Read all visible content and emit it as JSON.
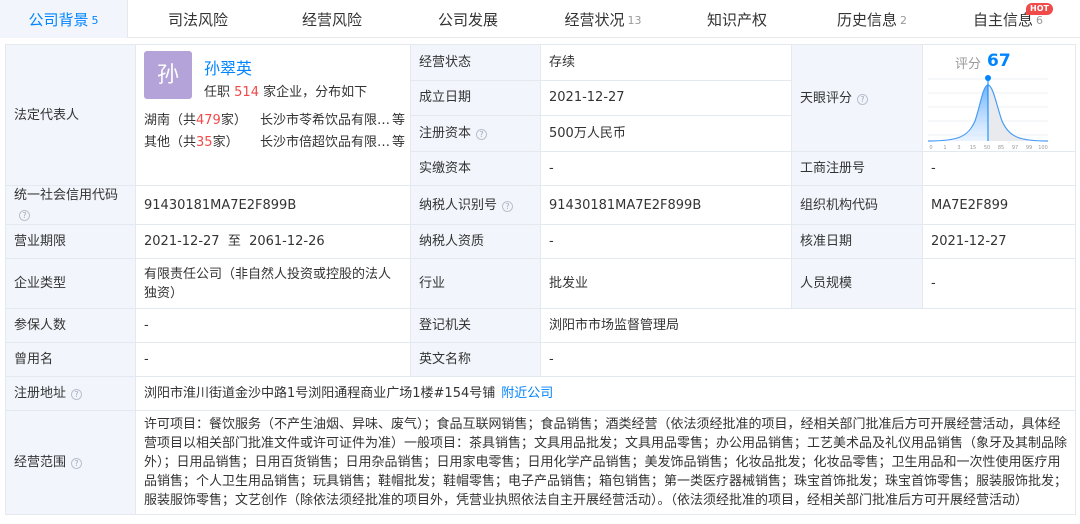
{
  "tabs": [
    {
      "label": "公司背景",
      "count": "5",
      "active": true
    },
    {
      "label": "司法风险",
      "count": ""
    },
    {
      "label": "经营风险",
      "count": ""
    },
    {
      "label": "公司发展",
      "count": ""
    },
    {
      "label": "经营状况",
      "count": "13"
    },
    {
      "label": "知识产权",
      "count": ""
    },
    {
      "label": "历史信息",
      "count": "2"
    },
    {
      "label": "自主信息",
      "count": "6",
      "badge": "HOT"
    }
  ],
  "legal_rep": {
    "label": "法定代表人",
    "avatar_char": "孙",
    "name": "孙翠英",
    "title_prefix": "任职",
    "title_count": "514",
    "title_suffix": "家企业，分布如下",
    "regions": [
      {
        "region": "湖南（共",
        "count": "479",
        "unit": "家）",
        "company": "长沙市苓希饮品有限…",
        "more": "等"
      },
      {
        "region": "其他（共",
        "count": "35",
        "unit": "家）",
        "company": "长沙市倍超饮品有限…",
        "more": "等"
      }
    ]
  },
  "status": {
    "label": "经营状态",
    "value": "存续"
  },
  "established": {
    "label": "成立日期",
    "value": "2021-12-27"
  },
  "reg_capital": {
    "label": "注册资本",
    "value": "500万人民币"
  },
  "paid_capital": {
    "label": "实缴资本",
    "value": "-"
  },
  "tianyan": {
    "label": "天眼评分",
    "score_label": "评分",
    "score": "67",
    "scale_ticks": [
      "0",
      "1",
      "3",
      "15",
      "50",
      "85",
      "97",
      "99",
      "100"
    ],
    "accent": "#0084ff"
  },
  "biz_reg_no": {
    "label": "工商注册号",
    "value": "-"
  },
  "credit_code": {
    "label": "统一社会信用代码",
    "value": "91430181MA7E2F899B"
  },
  "tax_id": {
    "label": "纳税人识别号",
    "value": "91430181MA7E2F899B"
  },
  "org_code": {
    "label": "组织机构代码",
    "value": "MA7E2F899"
  },
  "biz_term": {
    "label": "营业期限",
    "value": "2021-12-27  至  2061-12-26"
  },
  "taxpayer_qual": {
    "label": "纳税人资质",
    "value": "-"
  },
  "approval_date": {
    "label": "核准日期",
    "value": "2021-12-27"
  },
  "company_type": {
    "label": "企业类型",
    "value": "有限责任公司（非自然人投资或控股的法人独资）"
  },
  "industry": {
    "label": "行业",
    "value": "批发业"
  },
  "staff_size": {
    "label": "人员规模",
    "value": "-"
  },
  "insured": {
    "label": "参保人数",
    "value": "-"
  },
  "reg_authority": {
    "label": "登记机关",
    "value": "浏阳市市场监督管理局"
  },
  "former_name": {
    "label": "曾用名",
    "value": "-"
  },
  "english_name": {
    "label": "英文名称",
    "value": "-"
  },
  "address": {
    "label": "注册地址",
    "value": "浏阳市淮川街道金沙中路1号浏阳通程商业广场1楼#154号铺",
    "link": "附近公司"
  },
  "scope": {
    "label": "经营范围",
    "value": "许可项目：餐饮服务（不产生油烟、异味、废气）；食品互联网销售；食品销售；酒类经营（依法须经批准的项目，经相关部门批准后方可开展经营活动，具体经营项目以相关部门批准文件或许可证件为准）一般项目：茶具销售；文具用品批发；文具用品零售；办公用品销售；工艺美术品及礼仪用品销售（象牙及其制品除外）；日用品销售；日用百货销售；日用杂品销售；日用家电零售；日用化学产品销售；美发饰品销售；化妆品批发；化妆品零售；卫生用品和一次性使用医疗用品销售；个人卫生用品销售；玩具销售；鞋帽批发；鞋帽零售；电子产品销售；箱包销售；第一类医疗器械销售；珠宝首饰批发；珠宝首饰零售；服装服饰批发；服装服饰零售；文艺创作（除依法须经批准的项目外，凭营业执照依法自主开展经营活动）。（依法须经批准的项目，经相关部门批准后方可开展经营活动）"
  }
}
